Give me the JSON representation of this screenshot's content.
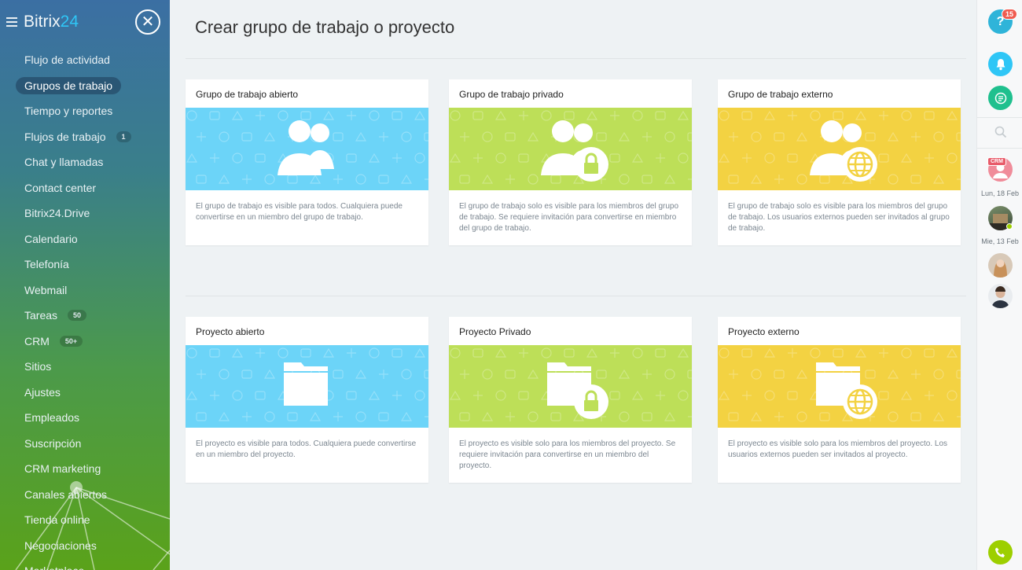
{
  "logo": {
    "text": "Bitrix",
    "suffix": "24"
  },
  "sidebar": {
    "items": [
      {
        "label": "Flujo de actividad"
      },
      {
        "label": "Grupos de trabajo",
        "active": true
      },
      {
        "label": "Tiempo y reportes"
      },
      {
        "label": "Flujos de trabajo",
        "counter": "1"
      },
      {
        "label": "Chat y llamadas"
      },
      {
        "label": "Contact center"
      },
      {
        "label": "Bitrix24.Drive"
      },
      {
        "label": "Calendario"
      },
      {
        "label": "Telefonía"
      },
      {
        "label": "Webmail"
      },
      {
        "label": "Tareas",
        "counter": "50"
      },
      {
        "label": "CRM",
        "counter": "50+"
      },
      {
        "label": "Sitios"
      },
      {
        "label": "Ajustes"
      },
      {
        "label": "Empleados"
      },
      {
        "label": "Suscripción"
      },
      {
        "label": "CRM marketing"
      },
      {
        "label": "Canales abiertos"
      },
      {
        "label": "Tienda online"
      },
      {
        "label": "Negociaciones"
      },
      {
        "label": "Marketplace"
      }
    ]
  },
  "main": {
    "title": "Crear grupo de trabajo o proyecto",
    "groups": [
      {
        "title": "Grupo de trabajo abierto",
        "color": "#6cd4f8",
        "icon": "users-icon",
        "desc": "El grupo de trabajo es visible para todos. Cualquiera puede convertirse en un miembro del grupo de trabajo."
      },
      {
        "title": "Grupo de trabajo privado",
        "color": "#bddf58",
        "icon": "users-lock-icon",
        "desc": "El grupo de trabajo solo es visible para los miembros del grupo de trabajo. Se requiere invitación para convertirse en miembro del grupo de trabajo."
      },
      {
        "title": "Grupo de trabajo externo",
        "color": "#f3d242",
        "icon": "users-globe-icon",
        "desc": "El grupo de trabajo solo es visible para los miembros del grupo de trabajo. Los usuarios externos pueden ser invitados al grupo de trabajo."
      }
    ],
    "projects": [
      {
        "title": "Proyecto abierto",
        "color": "#6cd4f8",
        "icon": "folder-icon",
        "desc": "El proyecto es visible para todos. Cualquiera puede convertirse en un miembro del proyecto."
      },
      {
        "title": "Proyecto Privado",
        "color": "#bddf58",
        "icon": "folder-lock-icon",
        "desc": "El proyecto es visible solo para los miembros del proyecto. Se requiere invitación para convertirse en un miembro del proyecto."
      },
      {
        "title": "Proyecto externo",
        "color": "#f3d242",
        "icon": "folder-globe-icon",
        "desc": "El proyecto es visible solo para los miembros del proyecto. Los usuarios externos pueden ser invitados al proyecto."
      }
    ]
  },
  "rightbar": {
    "help_badge": "15",
    "crm_tag": "CRM",
    "dates": [
      "Lun, 18 Feb",
      "Mie, 13 Feb"
    ]
  }
}
